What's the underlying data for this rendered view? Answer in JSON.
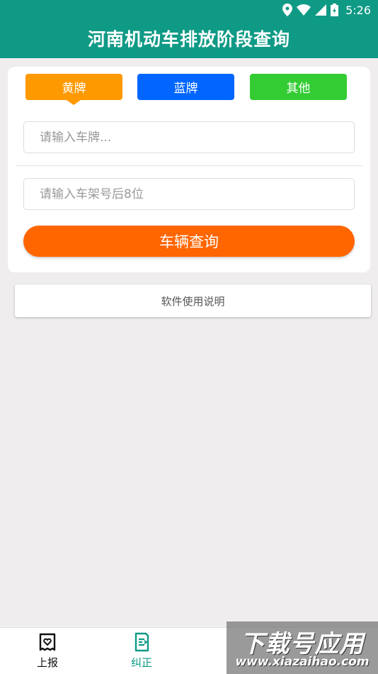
{
  "status_bar": {
    "time": "5:26"
  },
  "header": {
    "title": "河南机动车排放阶段查询"
  },
  "plate_types": [
    {
      "label": "黄牌",
      "color": "#ff9900",
      "selected": true
    },
    {
      "label": "蓝牌",
      "color": "#0066ff",
      "selected": false
    },
    {
      "label": "其他",
      "color": "#33cc33",
      "selected": false
    }
  ],
  "form": {
    "plate_input": {
      "placeholder": "请输入车牌...",
      "value": ""
    },
    "frame_input": {
      "placeholder": "请输入车架号后8位",
      "value": ""
    },
    "query_button": "车辆查询"
  },
  "help_button": "软件使用说明",
  "bottom_nav": [
    {
      "label": "上报",
      "icon": "report-icon",
      "active": false
    },
    {
      "label": "纠正",
      "icon": "edit-icon",
      "active": true
    }
  ],
  "watermark": {
    "text": "下载号应用",
    "url": "www.xiazaihao.com"
  },
  "colors": {
    "header": "#0f9a86",
    "query_button": "#ff6600",
    "background": "#efedee"
  }
}
